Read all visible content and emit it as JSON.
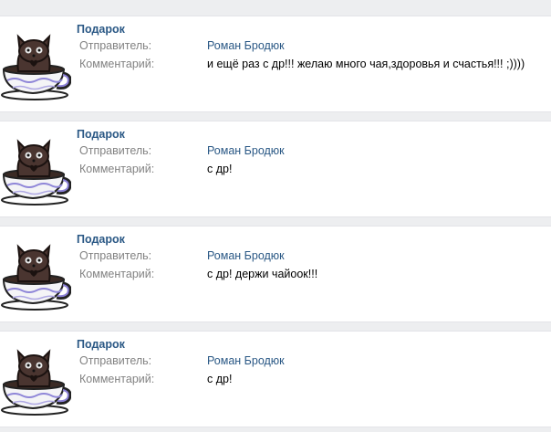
{
  "labels": {
    "sender": "Отправитель:",
    "comment": "Комментарий:"
  },
  "gifts": [
    {
      "title": "Подарок",
      "sender": "Роман Бродюк",
      "comment": "и ещё раз с др!!! желаю много чая,здоровья и счастья!!! ;))))",
      "icon": "cat-in-teacup-icon"
    },
    {
      "title": "Подарок",
      "sender": "Роман Бродюк",
      "comment": "с др!",
      "icon": "cat-in-teacup-icon"
    },
    {
      "title": "Подарок",
      "sender": "Роман Бродюк",
      "comment": "с др! держи чайоок!!!",
      "icon": "cat-in-teacup-icon"
    },
    {
      "title": "Подарок",
      "sender": "Роман Бродюк",
      "comment": "с др!",
      "icon": "cat-in-teacup-icon"
    }
  ],
  "colors": {
    "link": "#2a5885",
    "label": "#828282",
    "background": "#edeef0",
    "card": "#ffffff"
  }
}
